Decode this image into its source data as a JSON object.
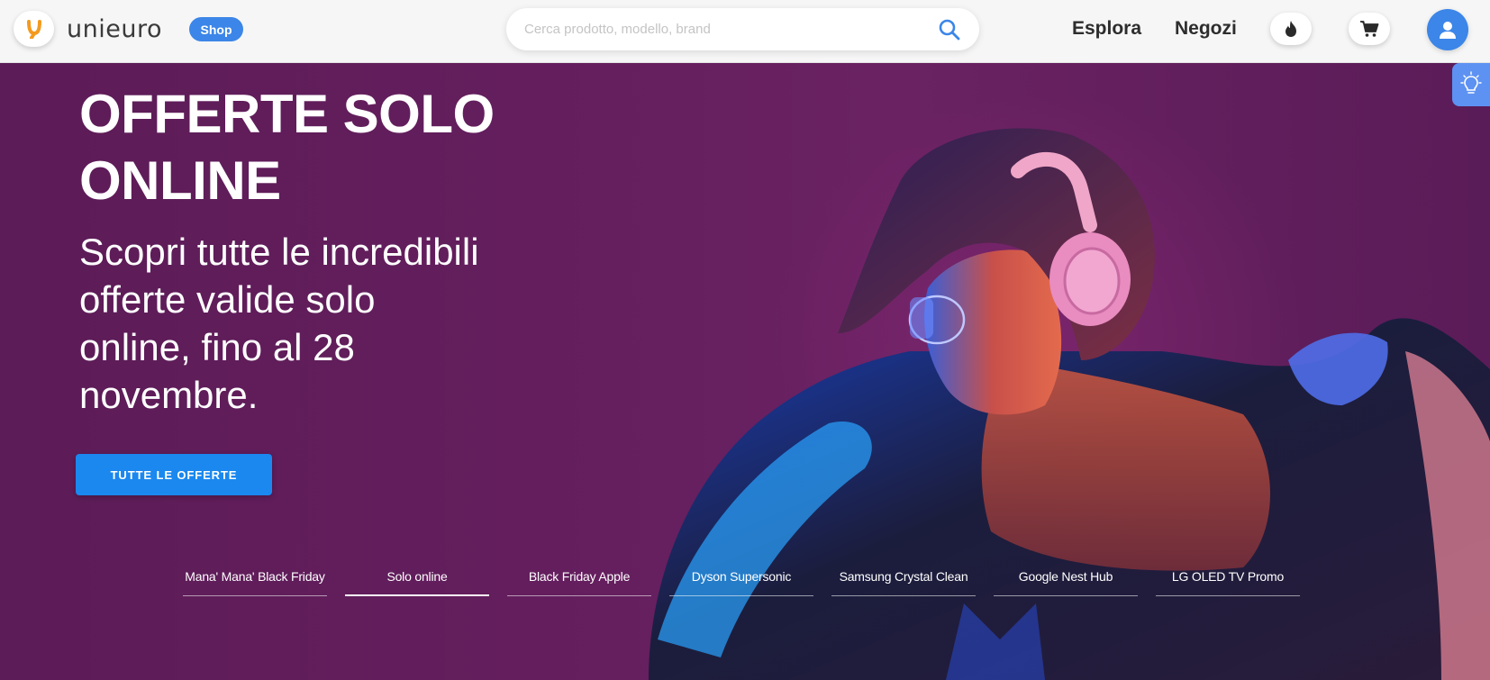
{
  "header": {
    "logo_text": "unieuro",
    "shop_label": "Shop",
    "search_placeholder": "Cerca prodotto, modello, brand",
    "nav": [
      {
        "label": "Esplora"
      },
      {
        "label": "Negozi"
      }
    ],
    "icons": [
      "flame-icon",
      "cart-icon",
      "user-icon",
      "search-icon"
    ],
    "accent_color": "#3b86e8"
  },
  "hero": {
    "title": "OFFERTE SOLO ONLINE",
    "subtitle": "Scopri tutte le incredibili offerte valide solo online, fino al 28 novembre.",
    "cta_label": "TUTTE LE OFFERTE",
    "cta_color": "#1a88ef",
    "background_color": "#5c1c57",
    "tabs": [
      {
        "label": "Mana' Mana' Black Friday",
        "active": false
      },
      {
        "label": "Solo online",
        "active": true
      },
      {
        "label": "Black Friday Apple",
        "active": false
      },
      {
        "label": "Dyson Supersonic",
        "active": false
      },
      {
        "label": "Samsung Crystal Clean",
        "active": false
      },
      {
        "label": "Google Nest Hub",
        "active": false
      },
      {
        "label": "LG OLED TV Promo",
        "active": false
      }
    ]
  },
  "side_widget": {
    "icon": "lightbulb-icon"
  }
}
